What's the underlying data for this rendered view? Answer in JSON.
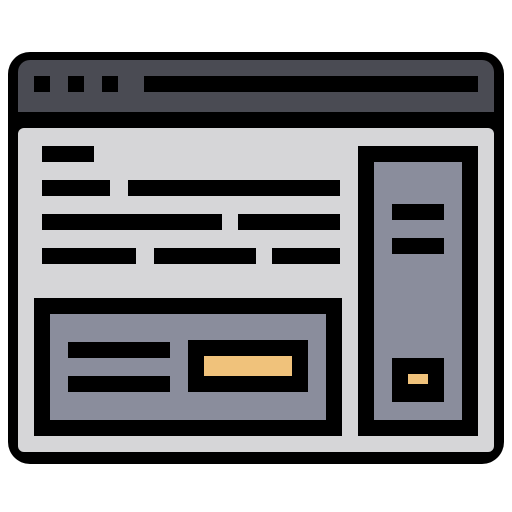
{
  "icon": {
    "name": "browser-window-layout-icon",
    "colors": {
      "outline": "#000000",
      "titlebar": "#4a4b53",
      "page_background": "#d6d6d8",
      "panel": "#8a8d9c",
      "accent": "#f0c27b",
      "white": "#ffffff"
    },
    "window_controls": [
      "dot",
      "dot",
      "dot"
    ]
  }
}
